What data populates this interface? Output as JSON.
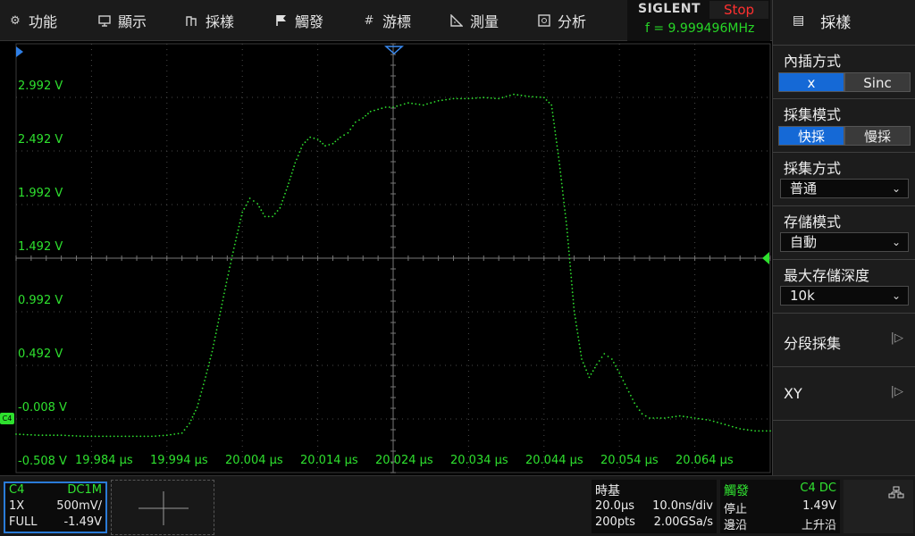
{
  "menu": [
    {
      "label": "功能",
      "icon": "gear-icon"
    },
    {
      "label": "顯示",
      "icon": "display-icon"
    },
    {
      "label": "採樣",
      "icon": "acquire-icon"
    },
    {
      "label": "觸發",
      "icon": "trigger-flag-icon"
    },
    {
      "label": "游標",
      "icon": "cursor-icon"
    },
    {
      "label": "測量",
      "icon": "measure-icon"
    },
    {
      "label": "分析",
      "icon": "analyze-icon"
    }
  ],
  "brand": "SIGLENT",
  "run_state": "Stop",
  "frequency": "f = 9.999496MHz",
  "right_panel": {
    "title": "採樣",
    "interpolation": {
      "label": "內插方式",
      "options": [
        "x",
        "Sinc"
      ],
      "selected": "x"
    },
    "acq_mode": {
      "label": "採集模式",
      "options": [
        "快採",
        "慢採"
      ],
      "selected": "快採"
    },
    "acq_method": {
      "label": "採集方式",
      "value": "普通"
    },
    "mem_mode": {
      "label": "存儲模式",
      "value": "自動"
    },
    "max_depth": {
      "label": "最大存儲深度",
      "value": "10k"
    },
    "segmented": "分段採集",
    "xy": "XY"
  },
  "channel": {
    "name": "C4",
    "coupling": "DC1M",
    "probe": "1X",
    "scale": "500mV/",
    "bandwidth": "FULL",
    "offset": "-1.49V",
    "marker": "C4",
    "color": "#2ee02e"
  },
  "timebase": {
    "title": "時基",
    "delay": "20.0μs",
    "scale": "10.0ns/div",
    "points": "200pts",
    "sample_rate": "2.00GSa/s"
  },
  "trigger": {
    "title": "觸發",
    "source": "C4 DC",
    "state": "停止",
    "level": "1.49V",
    "type": "邊沿",
    "slope": "上升沿"
  },
  "y_labels": [
    "2.992 V",
    "2.492 V",
    "1.992 V",
    "1.492 V",
    "0.992 V",
    "0.492 V",
    "-0.008 V",
    "-0.508 V"
  ],
  "x_labels": [
    "19.984 μs",
    "19.994 μs",
    "20.004 μs",
    "20.014 μs",
    "20.024 μs",
    "20.034 μs",
    "20.044 μs",
    "20.054 μs",
    "20.064 μs"
  ],
  "chart_data": {
    "type": "scatter",
    "x_unit": "μs",
    "y_unit": "V",
    "xlim": [
      19.974,
      20.074
    ],
    "ylim": [
      -0.508,
      3.492
    ],
    "grid": true,
    "series": [
      {
        "name": "C4",
        "color": "#2ee02e",
        "x": [
          19.974,
          19.977,
          19.98,
          19.983,
          19.986,
          19.989,
          19.992,
          19.994,
          19.996,
          19.997,
          19.998,
          19.999,
          20.0,
          20.001,
          20.002,
          20.003,
          20.004,
          20.005,
          20.006,
          20.007,
          20.008,
          20.009,
          20.01,
          20.011,
          20.012,
          20.013,
          20.014,
          20.015,
          20.016,
          20.017,
          20.018,
          20.019,
          20.02,
          20.021,
          20.022,
          20.023,
          20.024,
          20.026,
          20.028,
          20.03,
          20.032,
          20.034,
          20.036,
          20.038,
          20.04,
          20.042,
          20.044,
          20.045,
          20.046,
          20.047,
          20.048,
          20.049,
          20.05,
          20.051,
          20.052,
          20.053,
          20.054,
          20.055,
          20.056,
          20.057,
          20.058,
          20.06,
          20.062,
          20.064,
          20.066,
          20.068,
          20.07,
          20.072,
          20.074
        ],
        "y": [
          -0.15,
          -0.16,
          -0.16,
          -0.17,
          -0.17,
          -0.17,
          -0.17,
          -0.16,
          -0.14,
          -0.05,
          0.1,
          0.35,
          0.62,
          0.96,
          1.3,
          1.62,
          1.92,
          2.05,
          2.0,
          1.88,
          1.88,
          1.96,
          2.16,
          2.38,
          2.55,
          2.62,
          2.6,
          2.54,
          2.56,
          2.62,
          2.66,
          2.76,
          2.8,
          2.86,
          2.88,
          2.9,
          2.9,
          2.94,
          2.92,
          2.96,
          2.98,
          2.98,
          2.99,
          2.98,
          3.02,
          3.0,
          2.99,
          2.92,
          2.4,
          1.8,
          1.0,
          0.55,
          0.38,
          0.5,
          0.6,
          0.55,
          0.42,
          0.28,
          0.14,
          0.04,
          0.0,
          0.0,
          0.02,
          0.0,
          -0.02,
          -0.06,
          -0.1,
          -0.12,
          -0.12
        ]
      }
    ]
  }
}
